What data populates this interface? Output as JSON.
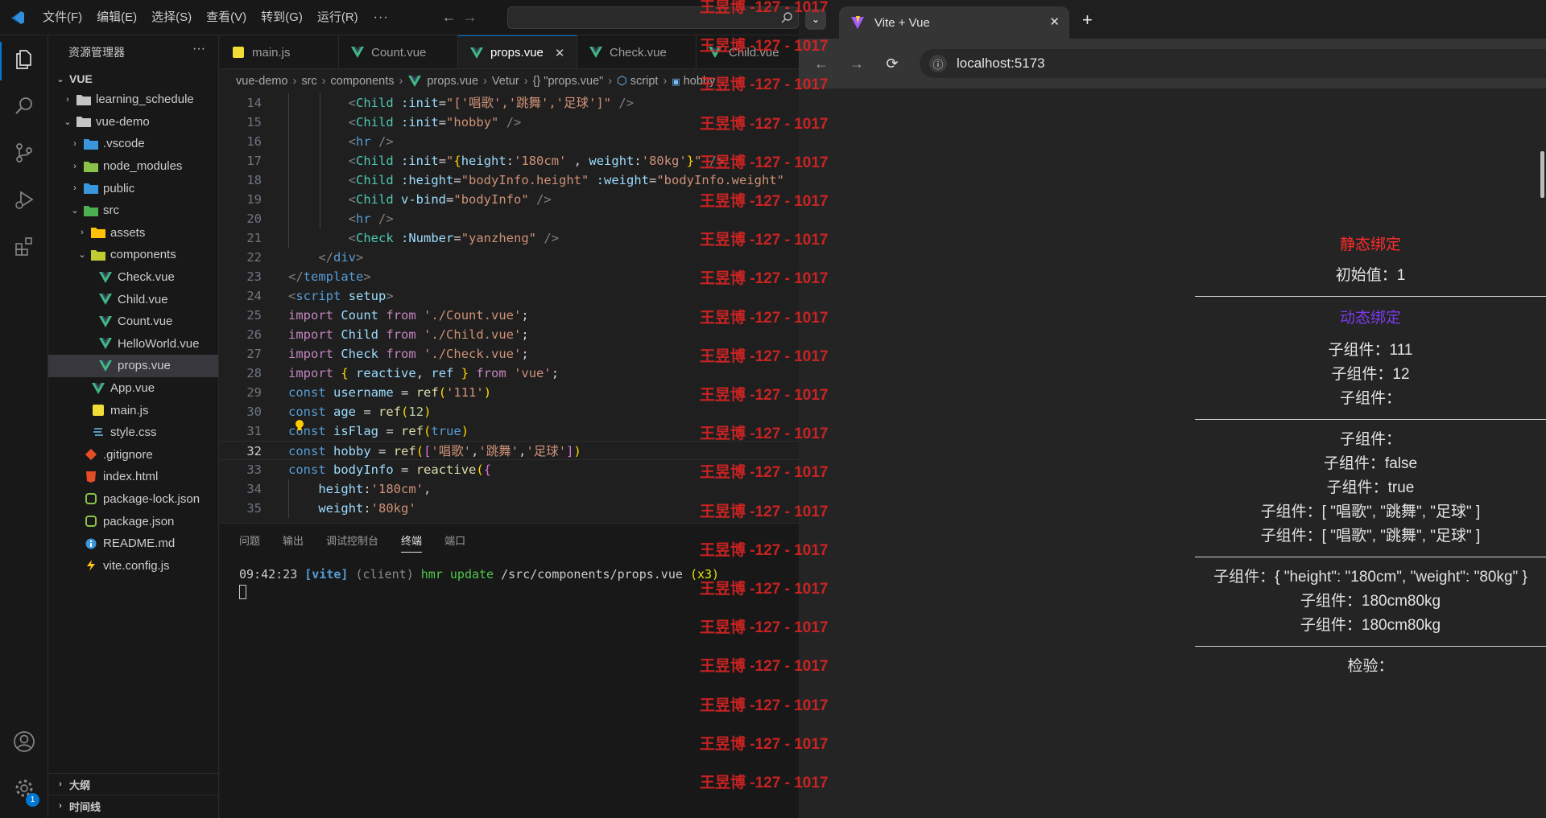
{
  "vscode": {
    "menu": [
      "文件(F)",
      "编辑(E)",
      "选择(S)",
      "查看(V)",
      "转到(G)",
      "运行(R)"
    ],
    "menu_more": "···",
    "sidebar": {
      "title": "资源管理器",
      "more": "···",
      "root": "VUE",
      "tree": [
        {
          "label": "learning_schedule",
          "type": "folder",
          "open": false,
          "depth": 1
        },
        {
          "label": "vue-demo",
          "type": "folder",
          "open": true,
          "depth": 1
        },
        {
          "label": ".vscode",
          "type": "folder-vscode",
          "open": false,
          "depth": 2
        },
        {
          "label": "node_modules",
          "type": "folder-node",
          "open": false,
          "depth": 2
        },
        {
          "label": "public",
          "type": "folder-public",
          "open": false,
          "depth": 2
        },
        {
          "label": "src",
          "type": "folder-src",
          "open": true,
          "depth": 2
        },
        {
          "label": "assets",
          "type": "folder-assets",
          "open": false,
          "depth": 3
        },
        {
          "label": "components",
          "type": "folder-comp",
          "open": true,
          "depth": 3
        },
        {
          "label": "Check.vue",
          "type": "vue",
          "depth": 4
        },
        {
          "label": "Child.vue",
          "type": "vue",
          "depth": 4
        },
        {
          "label": "Count.vue",
          "type": "vue",
          "depth": 4
        },
        {
          "label": "HelloWorld.vue",
          "type": "vue",
          "depth": 4
        },
        {
          "label": "props.vue",
          "type": "vue",
          "depth": 4,
          "selected": true
        },
        {
          "label": "App.vue",
          "type": "vue",
          "depth": 3
        },
        {
          "label": "main.js",
          "type": "js",
          "depth": 3
        },
        {
          "label": "style.css",
          "type": "css",
          "depth": 3
        },
        {
          "label": ".gitignore",
          "type": "git",
          "depth": 2
        },
        {
          "label": "index.html",
          "type": "html",
          "depth": 2
        },
        {
          "label": "package-lock.json",
          "type": "npm",
          "depth": 2
        },
        {
          "label": "package.json",
          "type": "npm",
          "depth": 2
        },
        {
          "label": "README.md",
          "type": "info",
          "depth": 2
        },
        {
          "label": "vite.config.js",
          "type": "vite",
          "depth": 2
        }
      ],
      "outline": "大纲",
      "timeline": "时间线"
    },
    "tabs": [
      {
        "label": "main.js",
        "type": "js"
      },
      {
        "label": "Count.vue",
        "type": "vue"
      },
      {
        "label": "props.vue",
        "type": "vue",
        "active": true,
        "close": "✕"
      },
      {
        "label": "Check.vue",
        "type": "vue"
      },
      {
        "label": "Child.vue",
        "type": "vue"
      }
    ],
    "breadcrumb": [
      "vue-demo",
      "src",
      "components",
      "props.vue",
      "Vetur",
      "{} \"props.vue\"",
      "script",
      "hobby"
    ],
    "current_line": 32,
    "panel_tabs": [
      "问题",
      "输出",
      "调试控制台",
      "终端",
      "端口"
    ],
    "active_panel_tab": "终端",
    "terminal": {
      "time": "09:42:23",
      "tag": "[vite]",
      "client": "(client)",
      "hmr": "hmr update",
      "path": "/src/components/props.vue",
      "count": "(x3)"
    },
    "activity_badge": "1"
  },
  "browser": {
    "tab_title": "Vite + Vue",
    "tab_close": "✕",
    "new_tab": "+",
    "url": "localhost:5173",
    "app": {
      "static_heading": "静态绑定",
      "initial": "初始值：1",
      "dynamic_heading": "动态绑定",
      "dyn_lines": [
        "子组件：111",
        "子组件：12",
        "子组件："
      ],
      "group2": [
        "子组件：",
        "子组件：false",
        "子组件：true",
        "子组件：[ \"唱歌\", \"跳舞\", \"足球\" ]",
        "子组件：[ \"唱歌\", \"跳舞\", \"足球\" ]"
      ],
      "group3": [
        "子组件：{ \"height\": \"180cm\", \"weight\": \"80kg\" }",
        "子组件：180cm80kg",
        "子组件：180cm80kg"
      ],
      "check": "检验："
    }
  },
  "watermark": {
    "text": "王昱博 -127 - 1017",
    "count": 21
  },
  "colors": {
    "accent": "#0078d4",
    "static_heading": "#ff2b2b",
    "dynamic_heading": "#7c3aed",
    "watermark": "#e02424"
  }
}
